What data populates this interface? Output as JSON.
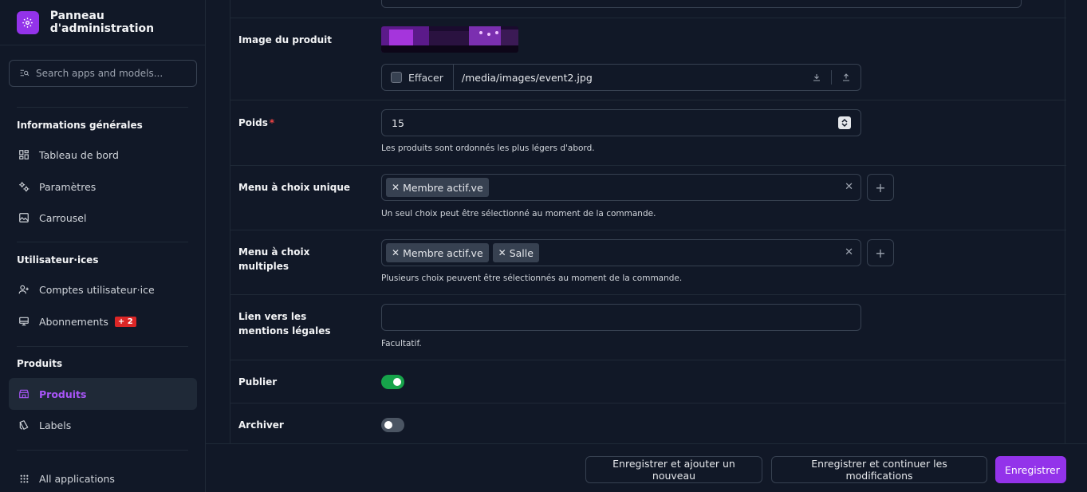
{
  "sidebar": {
    "brand": "Panneau d'administration",
    "search_placeholder": "Search apps and models...",
    "sections": [
      {
        "title": "Informations générales",
        "items": [
          {
            "label": "Tableau de bord",
            "icon": "dashboard-icon"
          },
          {
            "label": "Paramètres",
            "icon": "settings-icon"
          },
          {
            "label": "Carrousel",
            "icon": "carousel-icon"
          }
        ]
      },
      {
        "title": "Utilisateur·ices",
        "items": [
          {
            "label": "Comptes utilisateur·ice",
            "icon": "user-add-icon"
          },
          {
            "label": "Abonnements",
            "icon": "subscription-icon",
            "badge": "+ 2"
          }
        ]
      },
      {
        "title": "Produits",
        "items": [
          {
            "label": "Produits",
            "icon": "store-icon",
            "active": true
          },
          {
            "label": "Labels",
            "icon": "labels-icon"
          }
        ]
      }
    ],
    "all_apps": "All applications"
  },
  "form": {
    "image": {
      "label": "Image du produit",
      "clear_label": "Effacer",
      "path": "/media/images/event2.jpg"
    },
    "weight": {
      "label": "Poids",
      "required_mark": "*",
      "value": "15",
      "help": "Les produits sont ordonnés les plus légers d'abord."
    },
    "single_choice": {
      "label": "Menu à choix unique",
      "chips": [
        "Membre actif.ve"
      ],
      "help": "Un seul choix peut être sélectionné au moment de la commande."
    },
    "multi_choice": {
      "label": "Menu à choix multiples",
      "chips": [
        "Membre actif.ve",
        "Salle"
      ],
      "help": "Plusieurs choix peuvent être sélectionnés au moment de la commande."
    },
    "legal_link": {
      "label": "Lien vers les mentions légales",
      "value": "",
      "help": "Facultatif."
    },
    "publish": {
      "label": "Publier",
      "on": true
    },
    "archive": {
      "label": "Archiver",
      "on": false
    }
  },
  "footer": {
    "save_add": "Enregistrer et ajouter un nouveau",
    "save_continue": "Enregistrer et continuer les modifications",
    "save": "Enregistrer"
  },
  "colors": {
    "accent": "#9333ea",
    "badge": "#dc2626",
    "toggle_on": "#16a34a",
    "background": "#111827"
  }
}
